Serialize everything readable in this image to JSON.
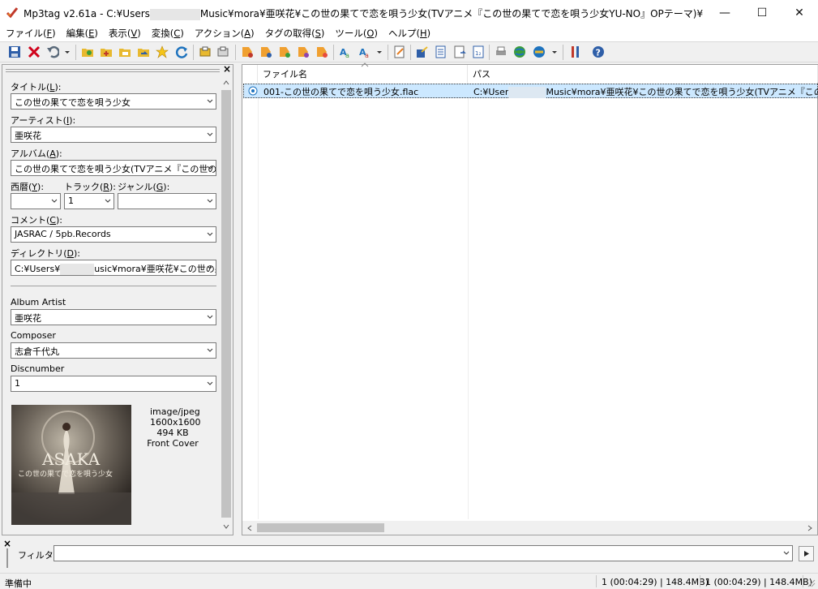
{
  "window": {
    "title": "Mp3tag v2.61a  -  C:¥Users¥　　　　　　¥Music¥mora¥亜咲花¥この世の果てで恋を唄う少女(TVアニメ『この世の果てで恋を唄う少女YU-NO』OPテーマ)¥",
    "title_app": "Mp3tag v2.61a  -  C:¥Users",
    "title_rest": "Music¥mora¥亜咲花¥この世の果てで恋を唄う少女(TVアニメ『この世の果てで恋を唄う少女YU-NO』OPテーマ)¥",
    "minimize": "—",
    "maximize": "☐",
    "close": "✕"
  },
  "menu": [
    {
      "label": "ファイル(",
      "key": "F",
      "end": ")"
    },
    {
      "label": "編集(",
      "key": "E",
      "end": ")"
    },
    {
      "label": "表示(",
      "key": "V",
      "end": ")"
    },
    {
      "label": "変換(",
      "key": "C",
      "end": ")"
    },
    {
      "label": "アクション(",
      "key": "A",
      "end": ")"
    },
    {
      "label": "タグの取得(",
      "key": "S",
      "end": ")"
    },
    {
      "label": "ツール(",
      "key": "O",
      "end": ")"
    },
    {
      "label": "ヘルプ(",
      "key": "H",
      "end": ")"
    }
  ],
  "tag_panel": {
    "title": {
      "label": "タイトル(",
      "key": "L",
      "end": "):",
      "value": "この世の果てで恋を唄う少女"
    },
    "artist": {
      "label": "アーティスト(",
      "key": "I",
      "end": "):",
      "value": "亜咲花"
    },
    "album": {
      "label": "アルバム(",
      "key": "A",
      "end": "):",
      "value": "この世の果てで恋を唄う少女(TVアニメ『この世の果"
    },
    "year": {
      "label": "西暦(",
      "key": "Y",
      "end": "):",
      "value": ""
    },
    "track": {
      "label": "トラック(",
      "key": "R",
      "end": "):",
      "value": "1"
    },
    "genre": {
      "label": "ジャンル(",
      "key": "G",
      "end": "):",
      "value": ""
    },
    "comment": {
      "label": "コメント(",
      "key": "C",
      "end": "):",
      "value": "JASRAC / 5pb.Records"
    },
    "directory": {
      "label": "ディレクトリ(",
      "key": "D",
      "end": "):",
      "value_a": "C:¥Users¥",
      "value_b": "usic¥mora¥亜咲花¥この世の果"
    },
    "album_artist": {
      "label": "Album Artist",
      "value": "亜咲花"
    },
    "composer": {
      "label": "Composer",
      "value": "志倉千代丸"
    },
    "discnumber": {
      "label": "Discnumber",
      "value": "1"
    },
    "cover": {
      "mime": "image/jpeg",
      "dimensions": "1600x1600",
      "size": "494 KB",
      "type": "Front Cover",
      "art_text_1": "ASAKA",
      "art_text_2": "この世の果てで恋を唄う少女"
    }
  },
  "file_list": {
    "columns": [
      "ファイル名",
      "パス"
    ],
    "rows": [
      {
        "filename": "001-この世の果てで恋を唄う少女.flac",
        "path_a": "C:¥User",
        "path_b": "Music¥mora¥亜咲花¥この世の果てで恋を唄う少女(TVアニメ『この世の"
      }
    ]
  },
  "filter": {
    "label": "フィルタ:",
    "value": ""
  },
  "status": {
    "left": "準備中",
    "selected": "1 (00:04:29) | 148.4MB)",
    "total": "1 (00:04:29) | 148.4MB)"
  },
  "colors": {
    "selection": "#cce8ff",
    "scroll_thumb": "#c2c2c2",
    "accent_blue": "#1e73be"
  },
  "icons": [
    "app-icon",
    "save-icon",
    "delete-icon",
    "undo-icon",
    "folder-open-icon",
    "add-folder-icon",
    "favorite-icon",
    "refresh-icon",
    "copy-tag-icon",
    "paste-tag-icon",
    "tag-source-icon",
    "rename-icon",
    "export-icon",
    "playlist-icon",
    "web-icon",
    "options-icon",
    "help-icon"
  ]
}
